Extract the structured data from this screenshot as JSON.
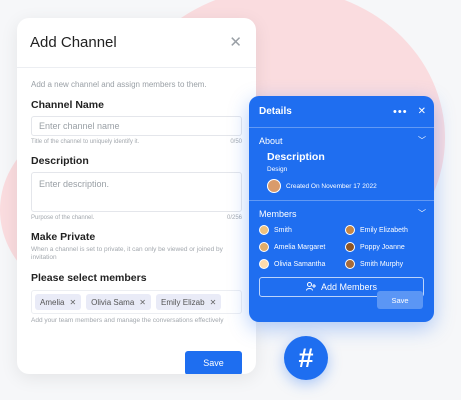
{
  "add_channel": {
    "title": "Add Channel",
    "intro": "Add a new channel and assign members to them.",
    "name_label": "Channel Name",
    "name_placeholder": "Enter channel name",
    "name_hint": "Title of the channel to uniquely identify it.",
    "name_count": "0/50",
    "desc_label": "Description",
    "desc_placeholder": "Enter description.",
    "desc_hint": "Purpose of the channel.",
    "desc_count": "0/256",
    "private_label": "Make Private",
    "private_sub": "When a channel is set to private, it can only be viewed or joined by invitation",
    "members_label": "Please select members",
    "selected_members": [
      "Amelia",
      "Olivia Sama",
      "Emily Elizab"
    ],
    "members_hint": "Add your team members and manage the conversations effectively",
    "save_label": "Save"
  },
  "details": {
    "title": "Details",
    "about_label": "About",
    "about_title": "Description",
    "about_sub": "Design",
    "created_text": "Created On November 17 2022",
    "members_label": "Members",
    "members": [
      {
        "name": "Smith",
        "avatar": "c1"
      },
      {
        "name": "Emily Elizabeth",
        "avatar": "c2"
      },
      {
        "name": "Amelia Margaret",
        "avatar": "c3"
      },
      {
        "name": "Poppy Joanne",
        "avatar": "c4"
      },
      {
        "name": "Olivia Samantha",
        "avatar": "c5"
      },
      {
        "name": "Smith Murphy",
        "avatar": "c6"
      }
    ],
    "add_members_label": "Add Members",
    "save_label": "Save"
  },
  "badge": {
    "symbol": "#"
  },
  "colors": {
    "primary": "#1f6ef0",
    "blob": "#fadcdf"
  }
}
